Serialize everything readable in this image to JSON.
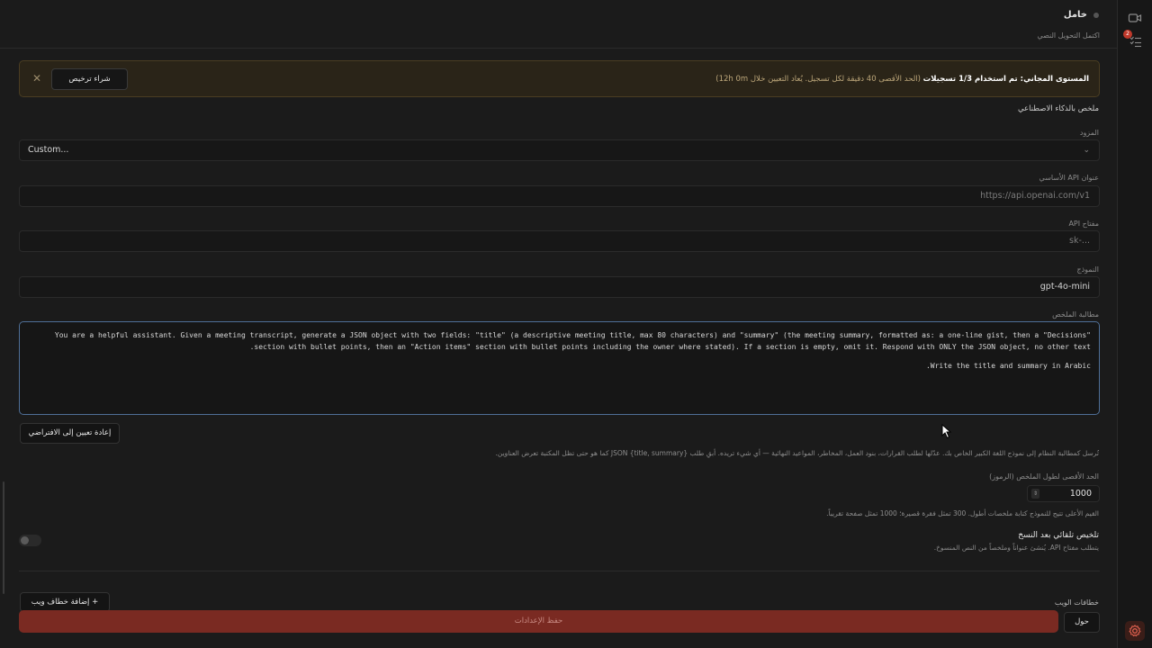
{
  "header": {
    "title": "خامل",
    "subtitle": "اكتمل التحويل النصي"
  },
  "banner": {
    "bold_text": "المستوى المجاني: تم استخدام 1/3 تسجيلات",
    "muted_text": "(الحد الأقصى 40 دقيقة لكل تسجيل. يُعاد التعيين خلال 12h 0m)",
    "buy_label": "شراء ترخيص"
  },
  "ai_summary": {
    "section_title": "ملخص بالذكاء الاصطناعي",
    "provider_label": "المزود",
    "provider_value": "Custom...",
    "base_url_label": "عنوان API الأساسي",
    "base_url_placeholder": "https://api.openai.com/v1",
    "api_key_label": "مفتاح API",
    "api_key_placeholder": "sk-...",
    "model_label": "النموذج",
    "model_value": "gpt-4o-mini",
    "prompt_label": "مطالبة الملخص",
    "prompt_paragraph1": "You are a helpful assistant. Given a meeting transcript, generate a JSON object with two fields: \"title\" (a descriptive meeting title, max 80 characters) and \"summary\" (the meeting summary, formatted as: a one-line gist, then a \"Decisions\" section with bullet points, then an \"Action items\" section with bullet points including the owner where stated). If a section is empty, omit it. Respond with ONLY the JSON object, no other text.",
    "prompt_paragraph2": "Write the title and summary in Arabic.",
    "reset_label": "إعادة تعيين إلى الافتراضي",
    "prompt_hint": "تُرسل كمطالبة النظام إلى نموذج اللغة الكبير الخاص بك. عدّلها لطلب القرارات، بنود العمل، المخاطر، المواعيد النهائية — أي شيء تريده. أبقِ طلب JSON {title, summary} كما هو حتى تظل المكتبة تعرض العناوين.",
    "max_len_label": "الحد الأقصى لطول الملخص (الرموز)",
    "max_len_value": "1000",
    "max_len_hint": "القيم الأعلى تتيح للنموذج كتابة ملخصات أطول. 300 تمثل فقرة قصيرة؛ 1000 تمثل صفحة تقريباً.",
    "auto_title": "تلخيص تلقائي بعد النسخ",
    "auto_hint": "يتطلب مفتاح API. يُنشئ عنواناً وملخصاً من النص المنسوخ.",
    "auto_enabled": false
  },
  "webhooks": {
    "label": "خطافات الويب",
    "add_label": "إضافة خطاف ويب"
  },
  "footer": {
    "save_label": "حفظ الإعدادات",
    "about_label": "حول"
  },
  "rail": {
    "badge_count": "2"
  },
  "colors": {
    "accent_save": "#7a2a22",
    "focus_border": "#4f6f97",
    "banner_bg": "#2a2418",
    "badge": "#c0392b"
  }
}
